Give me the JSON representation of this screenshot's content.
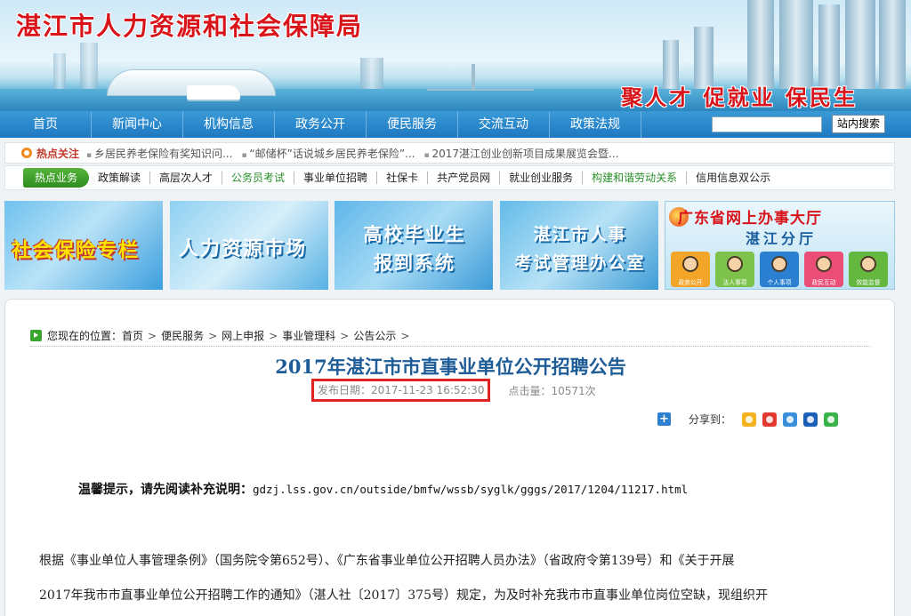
{
  "banner": {
    "site_title": "湛江市人力资源和社会保障局",
    "slogan": "聚人才 促就业 保民生"
  },
  "nav": {
    "items": [
      "首页",
      "新闻中心",
      "机构信息",
      "政务公开",
      "便民服务",
      "交流互动",
      "政策法规"
    ],
    "search_value": "",
    "search_button": "站内搜索"
  },
  "hot": {
    "label": "热点关注",
    "links": [
      "乡居民养老保险有奖知识问...",
      "“邮储杯”话说城乡居民养老保险”...",
      "2017湛江创业创新项目成果展览会暨..."
    ]
  },
  "business": {
    "label": "热点业务",
    "links": [
      {
        "text": "政策解读",
        "color": "#222222"
      },
      {
        "text": "高层次人才",
        "color": "#222222"
      },
      {
        "text": "公务员考试",
        "color": "#2a8f2a"
      },
      {
        "text": "事业单位招聘",
        "color": "#222222"
      },
      {
        "text": "社保卡",
        "color": "#222222"
      },
      {
        "text": "共产党员网",
        "color": "#222222"
      },
      {
        "text": "就业创业服务",
        "color": "#222222"
      },
      {
        "text": "构建和谐劳动关系",
        "color": "#2a8f2a"
      },
      {
        "text": "信用信息双公示",
        "color": "#222222"
      }
    ]
  },
  "tiles": {
    "social_insurance": "社会保险专栏",
    "hr_market": "人力资源市场",
    "graduate_line1": "高校毕业生",
    "graduate_line2": "报到系统",
    "exam_line1": "湛江市人事",
    "exam_line2": "考试管理办公室",
    "hall_title": "广东省网上办事大厅",
    "hall_sub": "湛江分厅",
    "hall_services": [
      "政务公开",
      "法人事项",
      "个人事项",
      "政民互动",
      "效能监督"
    ]
  },
  "breadcrumb": {
    "prefix": "您现在的位置：",
    "items": [
      "首页",
      "便民服务",
      "网上申报",
      "事业管理科",
      "公告公示"
    ]
  },
  "article": {
    "title": "2017年湛江市市直事业单位公开招聘公告",
    "date": "发布日期：2017-11-23 16:52:30",
    "hits": "点击量：10571次",
    "share_label": "分享到：",
    "tip_label": "温馨提示，请先阅读补充说明：",
    "tip_url": "gdzj.lss.gov.cn/outside/bmfw/wssb/syglk/gggs/2017/1204/11217.html",
    "para1": "根据《事业单位人事管理条例》（国务院令第652号）、《广东省事业单位公开招聘人员办法》（省政府令第139号）和《关于开展",
    "para2": "2017年我市市直事业单位公开招聘工作的通知》（湛人社〔2017〕375号）规定，为及时补充我市市直事业单位岗位空缺，现组织开"
  },
  "colors": {
    "brand_red": "#d8141a",
    "nav_blue": "#1e78c2",
    "title_blue": "#1d5c96",
    "highlight_red": "#e02424",
    "biz_green": "#2e8d1f"
  }
}
